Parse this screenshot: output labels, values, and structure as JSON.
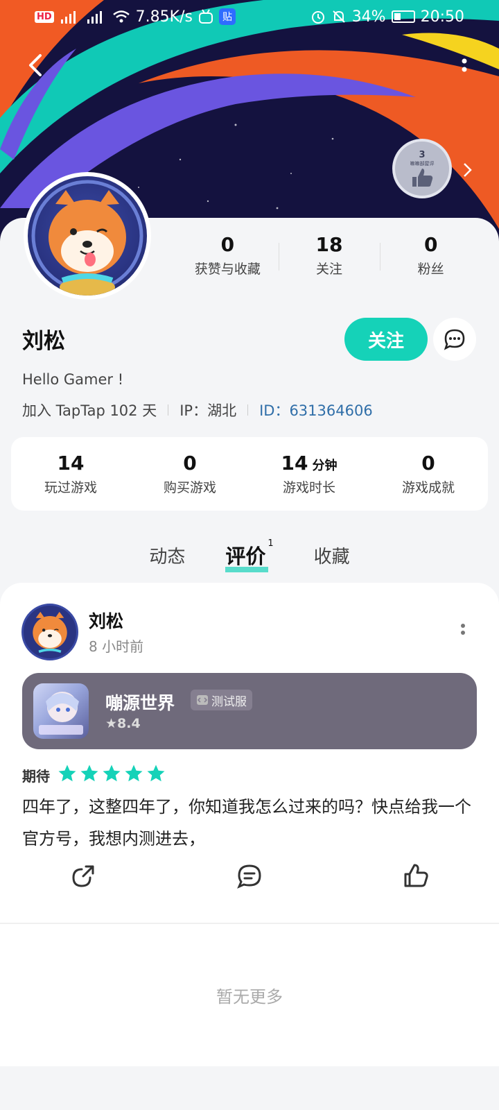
{
  "status_bar": {
    "network_speed": "7.85K/s",
    "battery": "34%",
    "battery_level": 0.34,
    "time": "20:50",
    "hd_label": "HD",
    "app_badge": "贴"
  },
  "header": {
    "badge_level": "3",
    "badge_caption": "嘛嘛部屋评"
  },
  "profile": {
    "username": "刘松",
    "follow_label": "关注",
    "bio": "Hello Gamer !",
    "joined": "加入 TapTap 102 天",
    "ip": "IP：湖北",
    "uid": "ID：631364606"
  },
  "stats_top": [
    {
      "num": "0",
      "label": "获赞与收藏"
    },
    {
      "num": "18",
      "label": "关注"
    },
    {
      "num": "0",
      "label": "粉丝"
    }
  ],
  "game_stats": [
    {
      "num": "14",
      "unit": "",
      "label": "玩过游戏"
    },
    {
      "num": "0",
      "unit": "",
      "label": "购买游戏"
    },
    {
      "num": "14",
      "unit": "分钟",
      "label": "游戏时长"
    },
    {
      "num": "0",
      "unit": "",
      "label": "游戏成就"
    }
  ],
  "tabs": {
    "items": [
      "动态",
      "评价",
      "收藏"
    ],
    "active_index": 1,
    "review_count": "1"
  },
  "review": {
    "author": "刘松",
    "time": "8 小时前",
    "game_name": "嘣源世界",
    "game_tag": "测试服",
    "game_rating": "8.4",
    "rating_label": "期待",
    "stars": 5,
    "text": "四年了，这整四年了，你知道我怎么过来的吗？快点给我一个官方号，我想内测进去，"
  },
  "footer": {
    "no_more": "暂无更多"
  },
  "colors": {
    "accent": "#15d2b8",
    "uid": "#2f6ea8",
    "game_card": "#6f6a7b"
  }
}
